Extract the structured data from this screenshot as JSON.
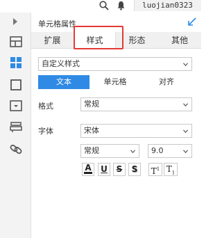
{
  "topbar": {
    "username": "luojian0323"
  },
  "panel": {
    "title": "单元格属性",
    "tabs": [
      "扩展",
      "样式",
      "形态",
      "其他"
    ],
    "active_tab": "样式",
    "style_select": "自定义样式",
    "subtabs": [
      "文本",
      "单元格",
      "对齐"
    ],
    "format_label": "格式",
    "format_value": "常规",
    "font_label": "字体",
    "font_family_value": "宋体",
    "font_style_value": "常规",
    "font_size_value": "9.0",
    "format_buttons": {
      "font_color": "A",
      "underline": "U",
      "strikethrough": "S",
      "shadow": "S",
      "superscript_base": "T",
      "superscript_mark": "1",
      "subscript_base": "T",
      "subscript_mark": "1"
    }
  },
  "colors": {
    "accent": "#2f8ae5",
    "highlight": "#e53935",
    "leftbar_active": "#2f8ae5"
  },
  "icons": [
    "search-icon",
    "bell-icon",
    "expand-arrow-icon",
    "grid-layout-icon",
    "component-blocks-icon",
    "frame-icon",
    "dropdown-box-icon",
    "stack-icon",
    "link-icon",
    "collapse-panel-icon"
  ]
}
